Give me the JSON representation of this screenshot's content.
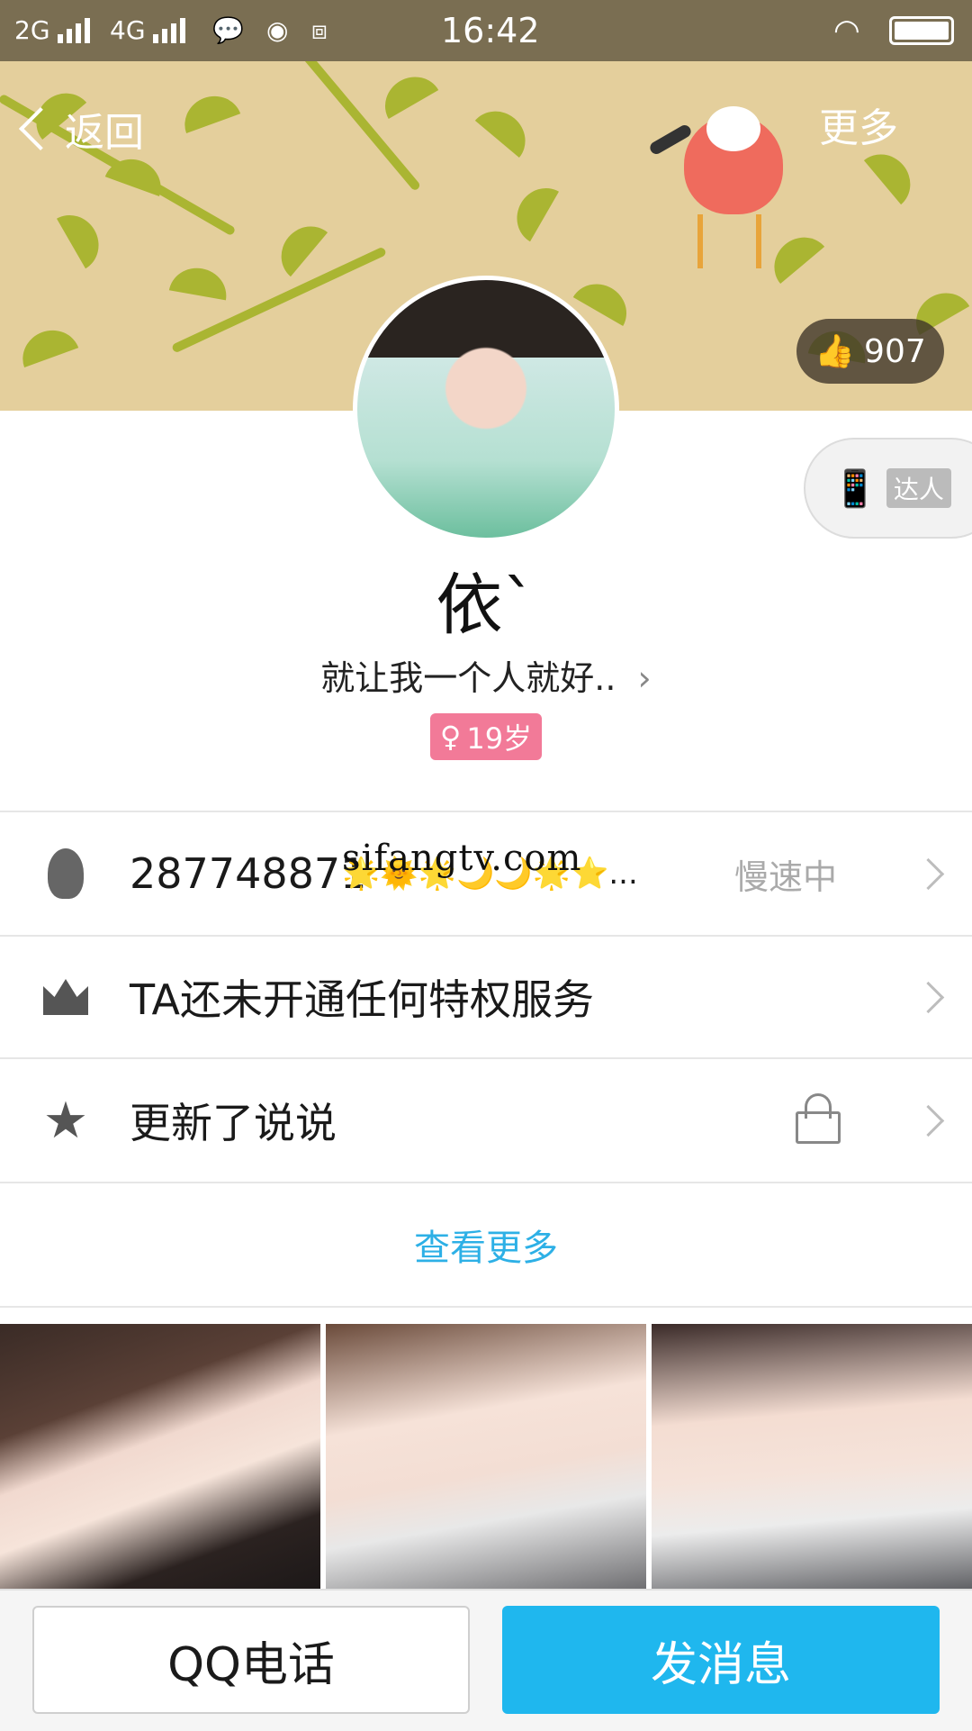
{
  "status_bar": {
    "network_1": "2G",
    "network_2": "4G",
    "time": "16:42",
    "icons": [
      "signal-icon",
      "wechat-icon",
      "globe-icon",
      "screenshot-icon",
      "wifi-icon",
      "battery-icon"
    ]
  },
  "header": {
    "back_label": "返回",
    "more_label": "更多",
    "likes_count": "907"
  },
  "badge": {
    "label": "达人"
  },
  "profile": {
    "nickname": "依`",
    "signature": "就让我一个人就好..",
    "age_label": "19岁"
  },
  "rows": [
    {
      "icon": "penguin-icon",
      "text": "287748871",
      "emoji": "🌟🌞🌟🌙🌙🌟⭐...",
      "status": "慢速中"
    },
    {
      "icon": "crown-icon",
      "text": "TA还未开通任何特权服务"
    },
    {
      "icon": "star-z-icon",
      "text": "更新了说说",
      "trailing_icon": "lock-icon"
    }
  ],
  "view_more_label": "查看更多",
  "watermark": "sifangtv.com",
  "bottom": {
    "call_label": "QQ电话",
    "message_label": "发消息"
  },
  "colors": {
    "accent": "#1fb7ee",
    "link": "#2db0e6",
    "age_tag": "#f27a98",
    "banner": "#e4cf9c"
  }
}
